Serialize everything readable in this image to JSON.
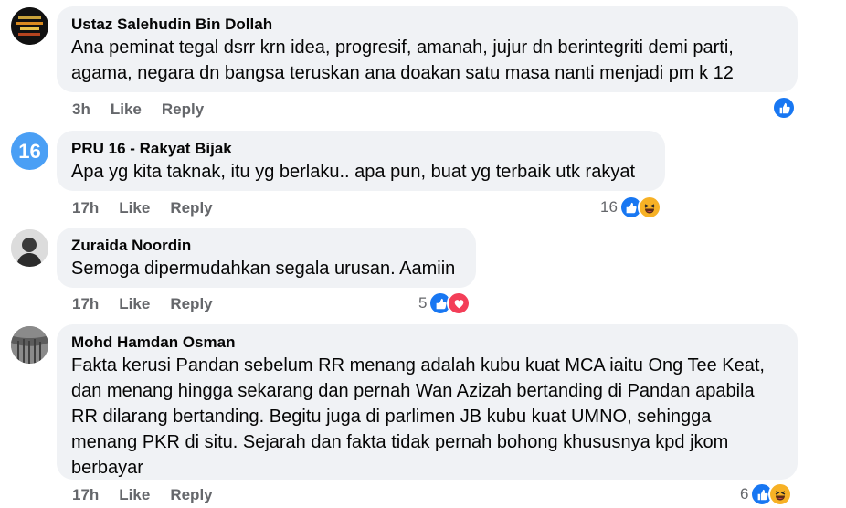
{
  "colors": {
    "like": "#1877f2",
    "haha": "#f7b125",
    "love": "#f33e58",
    "bubble": "#f0f2f5",
    "meta": "#65676b"
  },
  "action_like": "Like",
  "action_reply": "Reply",
  "comments": [
    {
      "author": "Ustaz Salehudin Bin Dollah",
      "lines": [
        "Ana peminat tegal dsrr krn idea, progresif, amanah, jujur dn berintegriti demi parti,",
        "agama, negara dn bangsa teruskan ana doakan satu masa nanti menjadi pm k 12"
      ],
      "time": "3h",
      "reaction_count": "",
      "reactions": [
        "like-icon"
      ]
    },
    {
      "author": "PRU 16 - Rakyat Bijak",
      "avatar_text": "16",
      "lines": [
        "Apa yg kita taknak, itu yg berlaku.. apa pun, buat yg terbaik utk rakyat"
      ],
      "time": "17h",
      "reaction_count": "16",
      "reactions": [
        "like-icon",
        "haha-icon"
      ]
    },
    {
      "author": "Zuraida Noordin",
      "lines": [
        "Semoga dipermudahkan segala urusan. Aamiin"
      ],
      "time": "17h",
      "reaction_count": "5",
      "reactions": [
        "like-icon",
        "love-icon"
      ]
    },
    {
      "author": "Mohd Hamdan Osman",
      "lines": [
        "Fakta kerusi Pandan sebelum RR menang adalah kubu kuat MCA iaitu Ong Tee Keat,",
        "dan menang hingga sekarang dan pernah Wan Azizah bertanding di Pandan apabila",
        "RR dilarang bertanding. Begitu juga di parlimen JB kubu kuat UMNO, sehingga",
        "menang PKR di situ. Sejarah dan fakta tidak pernah bohong khususnya kpd jkom",
        "berbayar"
      ],
      "time": "17h",
      "reaction_count": "6",
      "reactions": [
        "like-icon",
        "haha-icon"
      ]
    }
  ]
}
